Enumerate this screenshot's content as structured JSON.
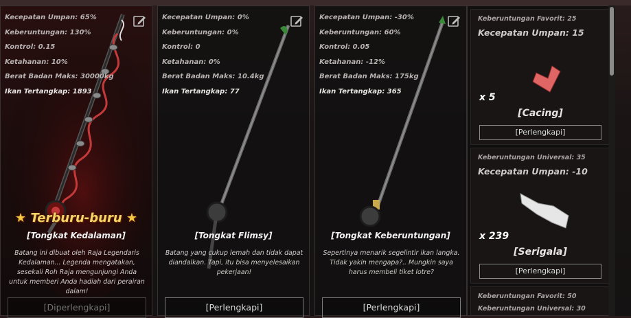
{
  "rods": [
    {
      "stats": [
        "Kecepatan Umpan: 65%",
        "Keberuntungan: 130%",
        "Kontrol: 0.15",
        "Ketahanan: 10%",
        "Berat Badan Maks: 30000kg",
        "Ikan Tertangkap: 1893"
      ],
      "badge": "Terburu-buru",
      "name": "[Tongkat Kedalaman]",
      "description": "Batang ini dibuat oleh Raja Legendaris Kedalaman... Legenda mengatakan, sesekali Roh Raja mengunjungi Anda untuk memberi Anda hadiah dari perairan dalam!",
      "button": "[Diperlengkapi]"
    },
    {
      "stats": [
        "Kecepatan Umpan: 0%",
        "Keberuntungan: 0%",
        "Kontrol: 0",
        "Ketahanan: 0%",
        "Berat Badan Maks: 10.4kg",
        "Ikan Tertangkap: 77"
      ],
      "name": "[Tongkat Flimsy]",
      "description": "Batang yang cukup lemah dan tidak dapat diandalkan. Tapi, itu bisa menyelesaikan pekerjaan!",
      "button": "[Perlengkapi]"
    },
    {
      "stats": [
        "Kecepatan Umpan: -30%",
        "Keberuntungan: 60%",
        "Kontrol: 0.05",
        "Ketahanan: -12%",
        "Berat Badan Maks: 175kg",
        "Ikan Tertangkap: 365"
      ],
      "name": "[Tongkat Keberuntungan]",
      "description": "Sepertinya menarik segelintir ikan langka. Tidak yakin mengapa?.. Mungkin saya harus membeli tiket lotre?",
      "button": "[Perlengkapi]"
    }
  ],
  "baits": [
    {
      "stat1": "Keberuntungan Favorit: 25",
      "stat2": "Kecepatan Umpan: 15",
      "qty": "x 5",
      "name": "[Cacing]",
      "button": "[Perlengkapi]"
    },
    {
      "stat1": "Keberuntungan Universal: 35",
      "stat2": "Kecepatan Umpan: -10",
      "qty": "x 239",
      "name": "[Serigala]",
      "button": "[Perlengkapi]"
    },
    {
      "stat1": "Keberuntungan Favorit: 50",
      "stat2": "Keberuntungan Universal: 30"
    }
  ],
  "icons": {
    "edit": "edit-icon",
    "star": "star-icon"
  },
  "colors": {
    "badge": "#f3d667",
    "accent_red": "#c43a3a",
    "bait_pink": "#e36a6a"
  }
}
